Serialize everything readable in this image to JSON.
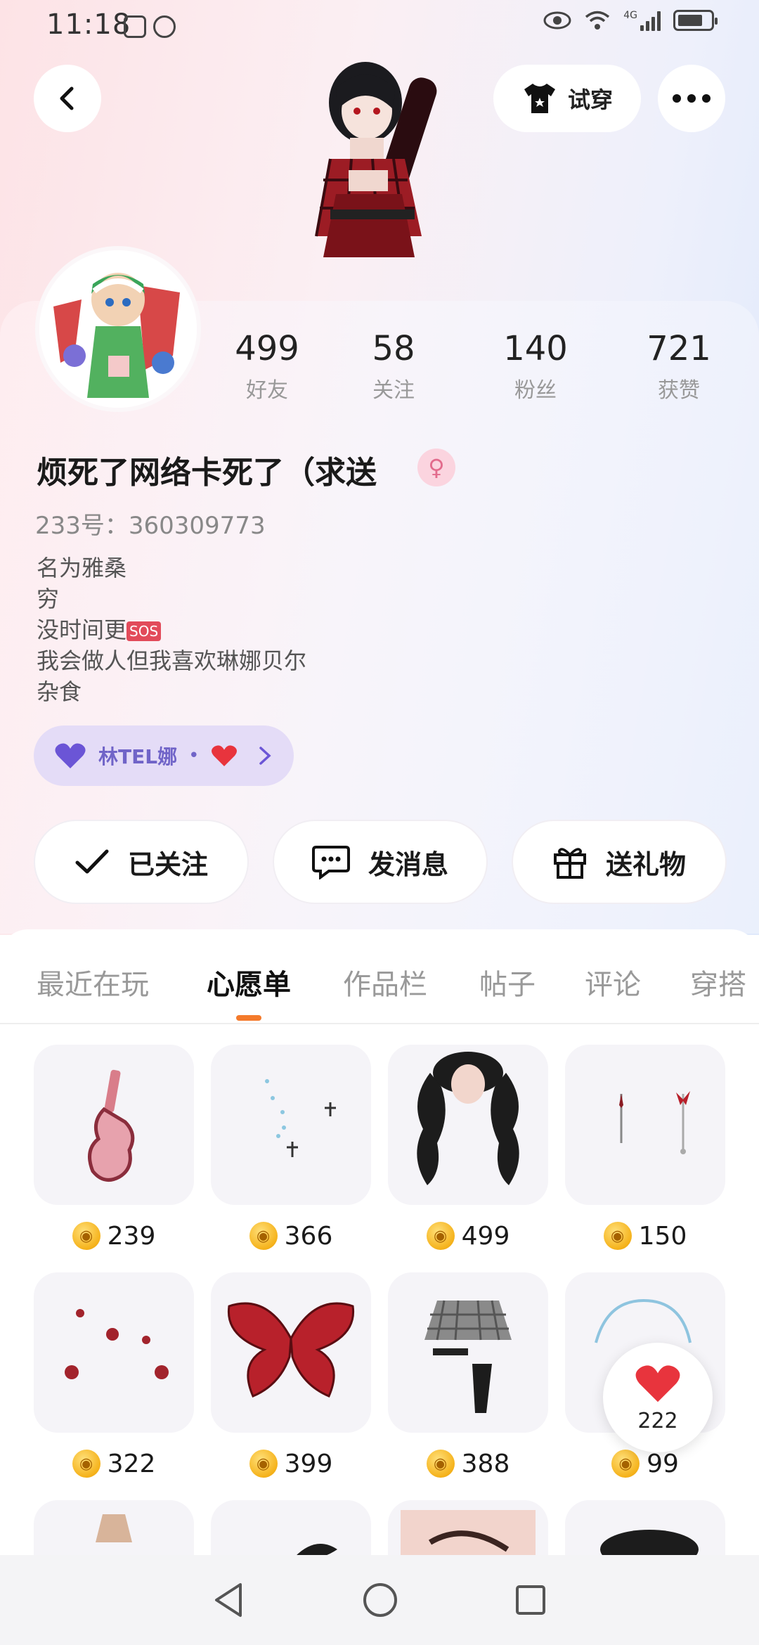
{
  "status_bar": {
    "time": "11:18",
    "network": "4G",
    "icons": [
      "screenshot-icon",
      "hand-icon",
      "eye-icon",
      "wifi-icon",
      "signal-icon",
      "battery-icon"
    ]
  },
  "header": {
    "back_icon": "chevron-left-icon",
    "try_on_label": "试穿",
    "try_on_icon": "tshirt-icon",
    "more_icon": "more-dots-icon"
  },
  "profile": {
    "stats": [
      {
        "value": "499",
        "label": "好友"
      },
      {
        "value": "58",
        "label": "关注"
      },
      {
        "value": "140",
        "label": "粉丝"
      },
      {
        "value": "721",
        "label": "获赞"
      }
    ],
    "nickname": "烦死了网络卡死了（求送",
    "gender_icon": "female-icon",
    "account_id": "233号：360309773",
    "bio_lines": [
      "名为雅桑",
      "穷",
      "没时间更",
      "我会做人但我喜欢琳娜贝尔",
      "杂食"
    ],
    "bio_sos": "SOS",
    "relation": {
      "name": "林TEL娜",
      "separator": "•"
    },
    "actions": [
      {
        "label": "已关注",
        "icon": "check-icon"
      },
      {
        "label": "发消息",
        "icon": "message-icon"
      },
      {
        "label": "送礼物",
        "icon": "gift-icon"
      }
    ]
  },
  "tabs": [
    "最近在玩",
    "心愿单",
    "作品栏",
    "帖子",
    "评论",
    "穿搭"
  ],
  "active_tab": "心愿单",
  "wishlist": [
    {
      "price": "239",
      "icon": "guitar-case-icon"
    },
    {
      "price": "366",
      "icon": "sparkle-cross-icon"
    },
    {
      "price": "499",
      "icon": "twin-curls-hair-icon"
    },
    {
      "price": "150",
      "icon": "earrings-icon"
    },
    {
      "price": "322",
      "icon": "rose-petals-icon"
    },
    {
      "price": "399",
      "icon": "butterfly-wings-icon"
    },
    {
      "price": "388",
      "icon": "plaid-skirt-icon"
    },
    {
      "price": "99",
      "icon": "necklace-icon"
    }
  ],
  "like_bubble": {
    "count": "222",
    "icon": "heart-icon"
  },
  "colors": {
    "accent": "#f47a2b",
    "relation_pill": "#e4dcf7",
    "relation_text": "#7064c8",
    "heart": "#e8343d"
  }
}
